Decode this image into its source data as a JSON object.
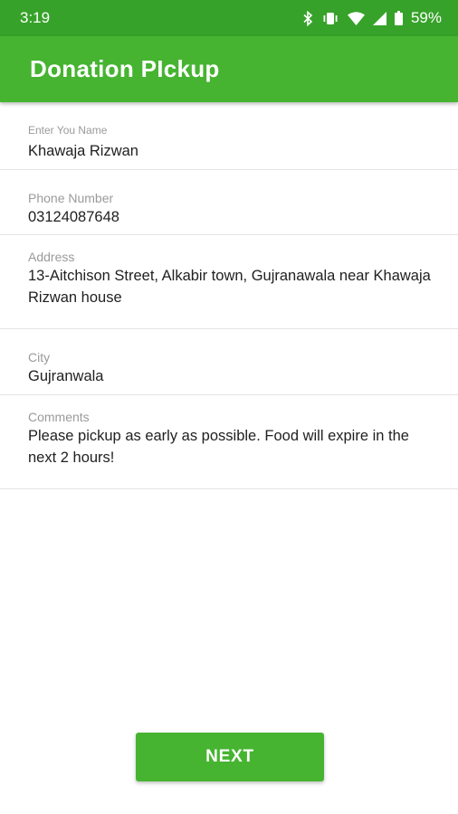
{
  "status_bar": {
    "time": "3:19",
    "battery_percent": "59%",
    "icons": [
      "bluetooth-icon",
      "vibrate-icon",
      "wifi-icon",
      "signal-icon",
      "battery-icon"
    ]
  },
  "app_bar": {
    "title": "Donation PIckup"
  },
  "form": {
    "name": {
      "label": "Enter You Name",
      "value": "Khawaja Rizwan"
    },
    "phone": {
      "label": "Phone Number",
      "value": "03124087648"
    },
    "address": {
      "label": "Address",
      "value": "13-Aitchison Street, Alkabir town, Gujranawala near Khawaja Rizwan house"
    },
    "city": {
      "label": "City",
      "value": "Gujranwala"
    },
    "comments": {
      "label": "Comments",
      "value": "Please pickup as early as possible. Food will expire in the next 2 hours!"
    }
  },
  "next_button": {
    "label": "NEXT"
  },
  "colors": {
    "status_bar": "#37a22a",
    "app_bar": "#46b431",
    "button": "#46b431"
  }
}
